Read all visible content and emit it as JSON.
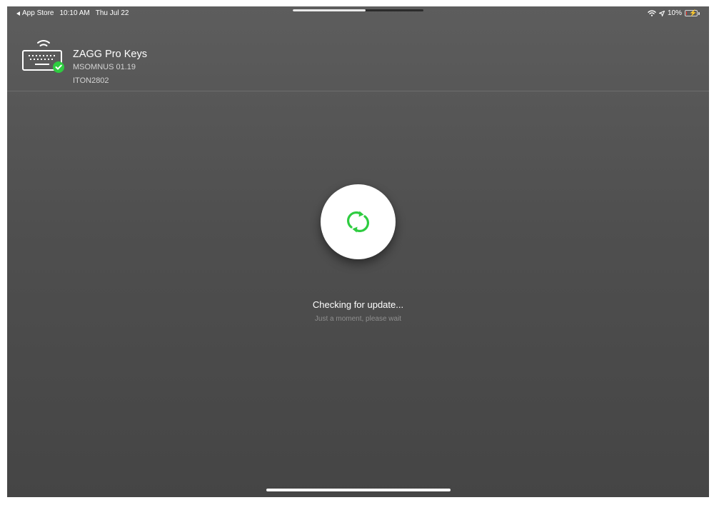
{
  "status_bar": {
    "back_label": "App Store",
    "time": "10:10 AM",
    "date": "Thu Jul 22",
    "battery_text": "10%",
    "battery_level": 0.1,
    "icons": [
      "wifi-icon",
      "location-icon",
      "battery-charging-icon"
    ]
  },
  "multitask": {
    "fill_fraction": 0.56
  },
  "device": {
    "name": "ZAGG Pro Keys",
    "firmware": "MSOMNUS 01.19",
    "id": "ITON2802",
    "icon": "keyboard-connected-icon",
    "badge": "check-icon"
  },
  "update": {
    "icon": "refresh-icon",
    "title": "Checking for update...",
    "subtitle": "Just a moment, please wait"
  },
  "colors": {
    "accent_green": "#2ecc40",
    "battery_low": "#ff3b30"
  }
}
